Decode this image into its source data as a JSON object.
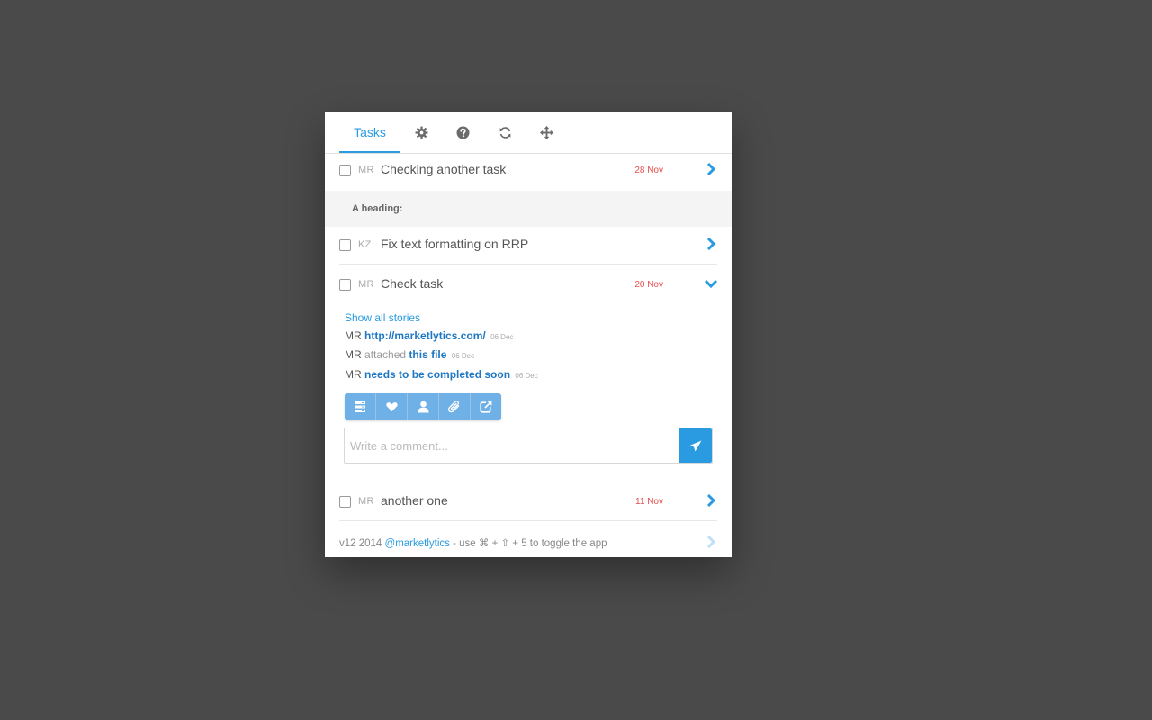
{
  "tabs": {
    "active_label": "Tasks",
    "icons": [
      "gear-icon",
      "help-icon",
      "refresh-icon",
      "move-icon"
    ]
  },
  "tasks": [
    {
      "initials": "MR",
      "title": "Checking another task",
      "date": "28 Nov"
    },
    {
      "initials": "KZ",
      "title": "Fix text formatting on RRP",
      "date": ""
    },
    {
      "initials": "MR",
      "title": "Check task",
      "date": "20 Nov"
    },
    {
      "initials": "MR",
      "title": "another one",
      "date": "11 Nov"
    }
  ],
  "heading": "A heading:",
  "expanded": {
    "show_all": "Show all stories",
    "stories": [
      {
        "who": "MR",
        "verb": "",
        "link": "http://marketlytics.com/",
        "date": "06 Dec"
      },
      {
        "who": "MR",
        "verb": "attached",
        "link": "this file",
        "date": "06 Dec"
      },
      {
        "who": "MR",
        "verb": "",
        "link": "needs to be completed soon",
        "date": "06 Dec"
      }
    ],
    "toolbar_icons": [
      "list-icon",
      "heart-icon",
      "user-icon",
      "paperclip-icon",
      "external-link-icon"
    ],
    "comment_placeholder": "Write a comment..."
  },
  "footer": {
    "version": "v12 2014",
    "handle": "@marketlytics",
    "hint": "- use ⌘ + ⇧ + 5 to toggle the app"
  },
  "colors": {
    "accent": "#2a9be0",
    "date": "#e84c4c",
    "background": "#4a4a4a"
  }
}
